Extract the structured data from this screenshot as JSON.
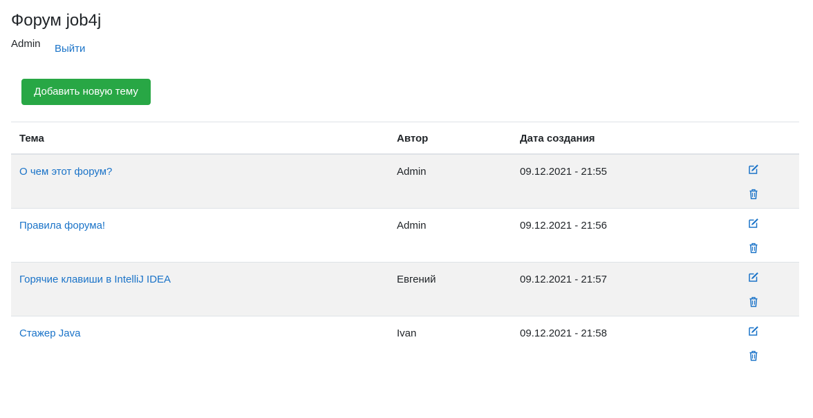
{
  "header": {
    "title": "Форум job4j",
    "username": "Admin",
    "logout_label": "Выйти"
  },
  "actions": {
    "add_topic_label": "Добавить новую тему"
  },
  "table": {
    "columns": [
      "Тема",
      "Автор",
      "Дата создания"
    ],
    "rows": [
      {
        "topic": "О чем этот форум?",
        "author": "Admin",
        "date": "09.12.2021 - 21:55"
      },
      {
        "topic": "Правила форума!",
        "author": "Admin",
        "date": "09.12.2021 - 21:56"
      },
      {
        "topic": "Горячие клавиши в IntelliJ IDEA",
        "author": "Евгений",
        "date": "09.12.2021 - 21:57"
      },
      {
        "topic": "Стажер Java",
        "author": "Ivan",
        "date": "09.12.2021 - 21:58"
      }
    ]
  },
  "colors": {
    "link": "#1a73c8",
    "button": "#28a745",
    "stripe": "#f2f2f2"
  },
  "icons": {
    "edit": "edit-icon",
    "delete": "trash-icon"
  }
}
